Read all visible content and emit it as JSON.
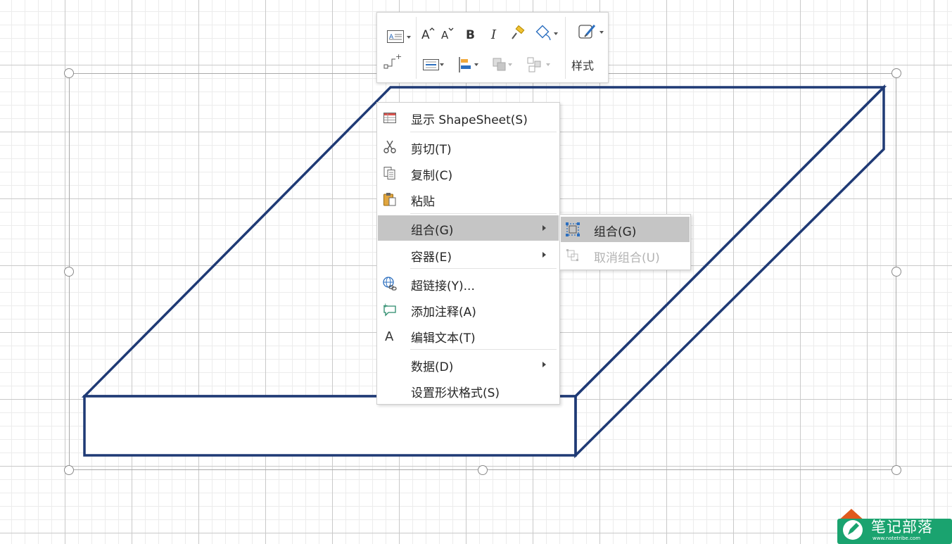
{
  "mini_toolbar": {
    "style_label": "样式",
    "icons": [
      "text-block-icon",
      "connector-icon",
      "grow-font-icon",
      "shrink-font-icon",
      "bold-icon",
      "italic-icon",
      "format-painter-icon",
      "fill-line-icon",
      "line-style-icon",
      "align-icon",
      "bring-forward-icon",
      "send-backward-icon",
      "quick-styles-icon"
    ]
  },
  "context_menu": {
    "items": [
      {
        "label": "显示 ShapeSheet(S)",
        "icon": "shapesheet-icon"
      },
      {
        "label": "剪切(T)",
        "icon": "cut-icon"
      },
      {
        "label": "复制(C)",
        "icon": "copy-icon"
      },
      {
        "label": "粘贴",
        "icon": "paste-icon"
      },
      {
        "label": "组合(G)",
        "icon": "",
        "submenu": true,
        "highlighted": true
      },
      {
        "label": "容器(E)",
        "icon": "",
        "submenu": true
      },
      {
        "label": "超链接(Y)...",
        "icon": "hyperlink-icon"
      },
      {
        "label": "添加注释(A)",
        "icon": "add-comment-icon"
      },
      {
        "label": "编辑文本(T)",
        "icon": "edit-text-icon"
      },
      {
        "label": "数据(D)",
        "icon": "",
        "submenu": true
      },
      {
        "label": "设置形状格式(S)",
        "icon": ""
      }
    ]
  },
  "submenu": {
    "items": [
      {
        "label": "组合(G)",
        "icon": "group-icon",
        "enabled": true,
        "highlighted": true
      },
      {
        "label": "取消组合(U)",
        "icon": "ungroup-icon",
        "enabled": false
      }
    ]
  },
  "watermark": {
    "title": "笔记部落",
    "url": "www.notetribe.com",
    "colors": {
      "badge": "#1aa36f",
      "house": "#e05a1e",
      "office": "#2a85d6"
    }
  },
  "shape": {
    "stroke_color": "#1f3a75"
  }
}
